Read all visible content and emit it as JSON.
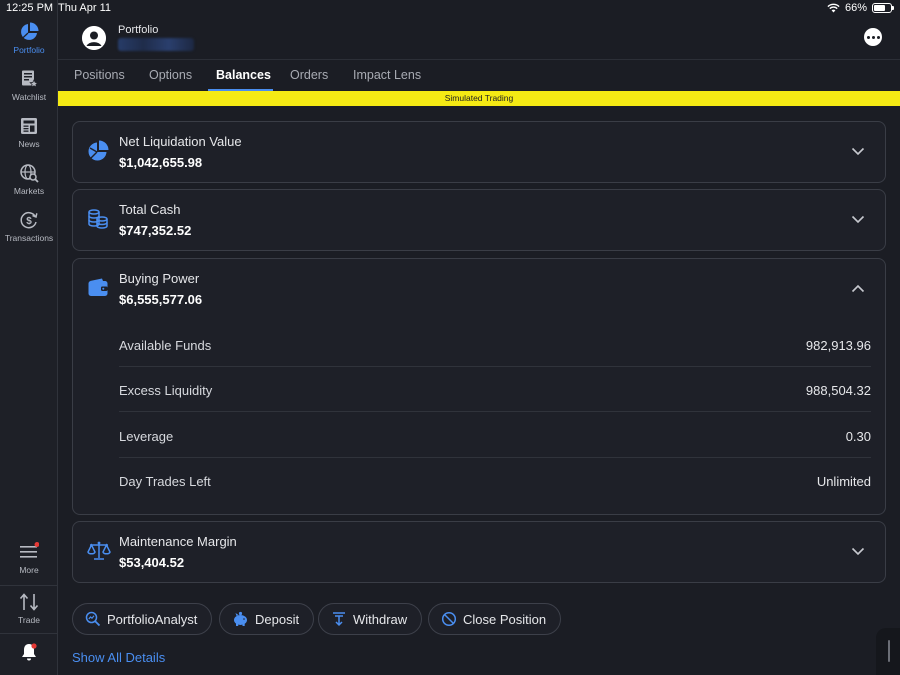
{
  "status_bar": {
    "time": "12:25 PM",
    "date": "Thu Apr 11",
    "battery": "66%"
  },
  "sidebar": {
    "items": [
      {
        "label": "Portfolio",
        "icon": "pie-chart-icon",
        "active": true
      },
      {
        "label": "Watchlist",
        "icon": "watchlist-icon"
      },
      {
        "label": "News",
        "icon": "newspaper-icon"
      },
      {
        "label": "Markets",
        "icon": "globe-search-icon"
      },
      {
        "label": "Transactions",
        "icon": "dollar-refresh-icon"
      }
    ],
    "more_label": "More",
    "trade_label": "Trade"
  },
  "header": {
    "title": "Portfolio"
  },
  "tabs": [
    {
      "label": "Positions"
    },
    {
      "label": "Options"
    },
    {
      "label": "Balances",
      "active": true
    },
    {
      "label": "Orders"
    },
    {
      "label": "Impact Lens"
    }
  ],
  "banner": "Simulated Trading",
  "cards": {
    "net_liquidation": {
      "title": "Net Liquidation Value",
      "value": "$1,042,655.98"
    },
    "total_cash": {
      "title": "Total Cash",
      "value": "$747,352.52"
    },
    "buying_power": {
      "title": "Buying Power",
      "value": "$6,555,577.06",
      "rows": [
        {
          "label": "Available Funds",
          "value": "982,913.96"
        },
        {
          "label": "Excess Liquidity",
          "value": "988,504.32"
        },
        {
          "label": "Leverage",
          "value": "0.30"
        },
        {
          "label": "Day Trades Left",
          "value": "Unlimited"
        }
      ]
    },
    "maintenance_margin": {
      "title": "Maintenance Margin",
      "value": "$53,404.52"
    }
  },
  "actions": {
    "portfolio_analyst": "PortfolioAnalyst",
    "deposit": "Deposit",
    "withdraw": "Withdraw",
    "close_position": "Close Position"
  },
  "show_all": "Show All Details",
  "colors": {
    "accent": "#4a8ef0",
    "banner": "#f5ea14",
    "background": "#1b1d24"
  }
}
